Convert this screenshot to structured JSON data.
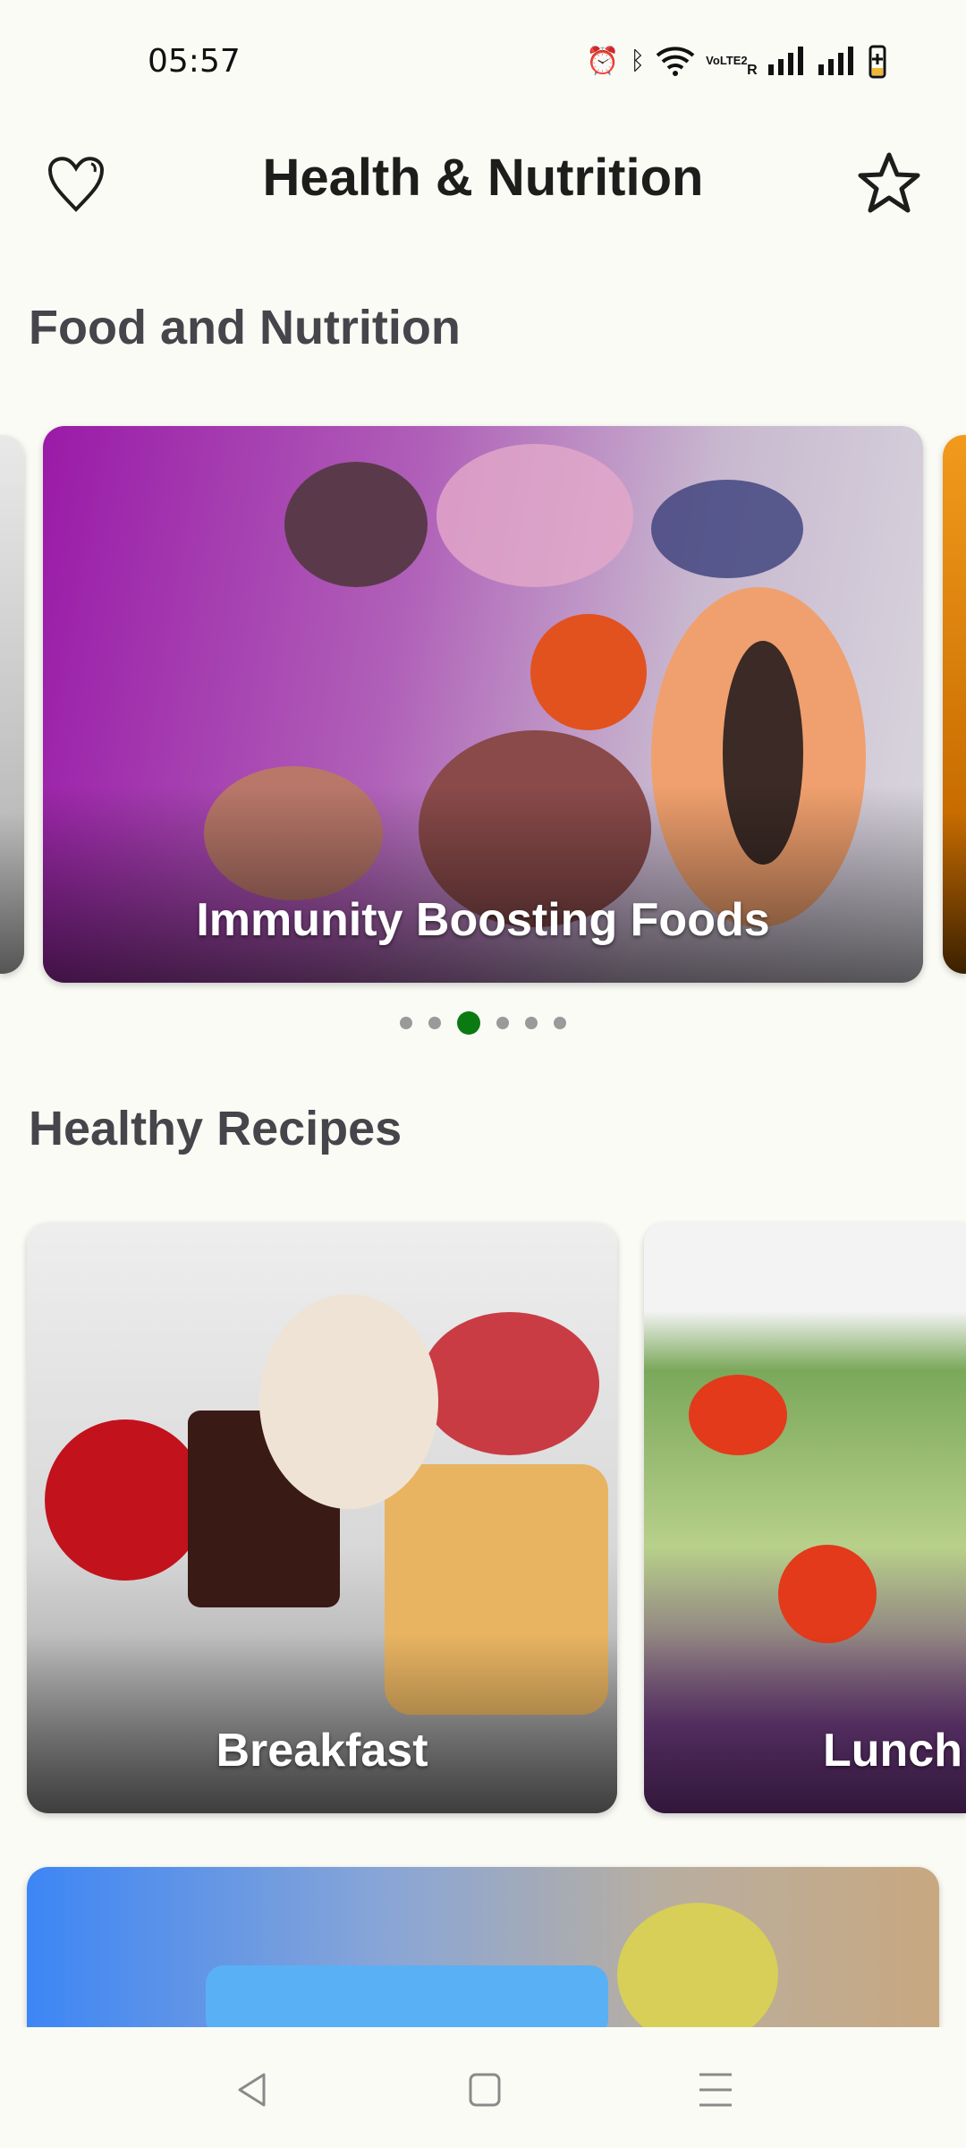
{
  "status_bar": {
    "time": "05:57",
    "icons": [
      "alarm-icon",
      "bluetooth-icon",
      "wifi-icon",
      "volte-icon",
      "signal-icon",
      "signal-icon",
      "battery-charging-icon"
    ],
    "volte_text": "VoLTE2",
    "roaming": "R"
  },
  "header": {
    "title": "Health & Nutrition",
    "left_icon": "heart-icon",
    "right_icon": "star-icon"
  },
  "food_section": {
    "title": "Food and Nutrition",
    "carousel": {
      "current_card": "Immunity Boosting Foods",
      "active_index": 3,
      "page_count": 6
    }
  },
  "recipes_section": {
    "title": "Healthy Recipes",
    "cards": [
      {
        "label": "Breakfast"
      },
      {
        "label": "Lunch"
      }
    ]
  },
  "colors": {
    "background": "#fbfbf6",
    "active_dot": "#0b7a12",
    "overlay_purple": "#9a1aa8",
    "overlay_blue": "#3d86f5"
  },
  "nav_bar": {
    "buttons": [
      "back-icon",
      "home-icon",
      "menu-icon"
    ]
  }
}
